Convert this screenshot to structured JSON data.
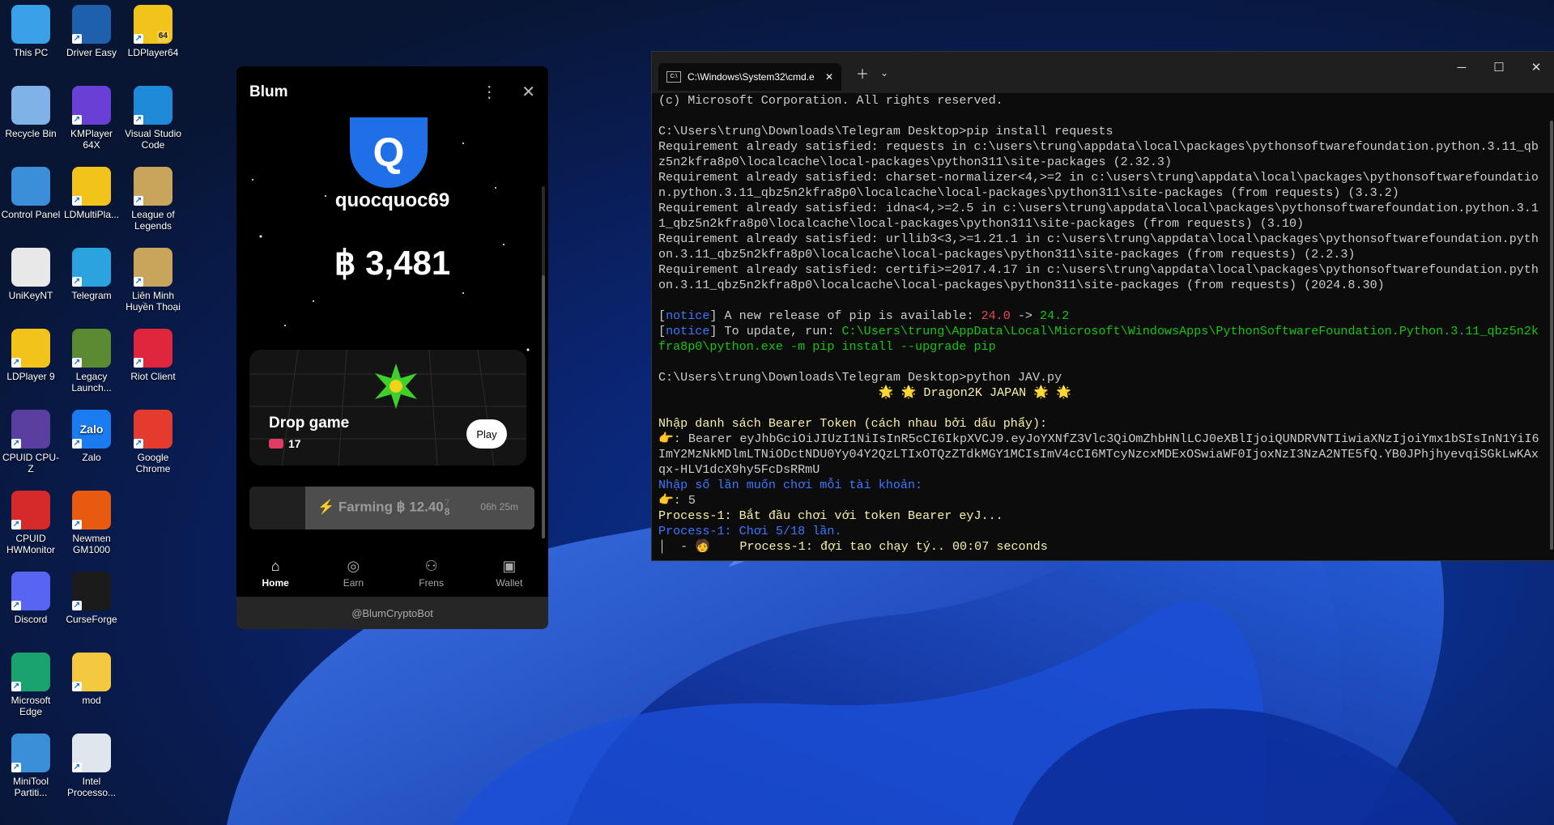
{
  "desktop": {
    "icons": [
      {
        "label": "This PC",
        "icon": "monitor-icon",
        "color": "#3aa0e8"
      },
      {
        "label": "Driver Easy",
        "icon": "driver-easy-icon",
        "color": "#1e5fae"
      },
      {
        "label": "LDPlayer64",
        "icon": "ldplayer-icon",
        "color": "#f2c31b",
        "badge": "64"
      },
      {
        "label": "Recycle Bin",
        "icon": "recycle-bin-icon",
        "color": "#7fb2e6"
      },
      {
        "label": "KMPlayer 64X",
        "icon": "kmplayer-icon",
        "color": "#6a3fd6"
      },
      {
        "label": "Visual Studio Code",
        "icon": "vscode-icon",
        "color": "#1f8ad8"
      },
      {
        "label": "Control Panel",
        "icon": "control-panel-icon",
        "color": "#3b8fd9"
      },
      {
        "label": "LDMultiPla...",
        "icon": "ldmultiplayer-icon",
        "color": "#f2c31b"
      },
      {
        "label": "League of Legends",
        "icon": "league-icon",
        "color": "#c8a55a"
      },
      {
        "label": "UniKeyNT",
        "icon": "unikey-icon",
        "color": "#e8e8e8"
      },
      {
        "label": "Telegram",
        "icon": "telegram-icon",
        "color": "#2aa3df"
      },
      {
        "label": "Liên Minh Huyền Thoại",
        "icon": "lmht-icon",
        "color": "#c8a55a"
      },
      {
        "label": "LDPlayer 9",
        "icon": "ldplayer9-icon",
        "color": "#f2c31b"
      },
      {
        "label": "Legacy Launch...",
        "icon": "minecraft-icon",
        "color": "#5c8a32"
      },
      {
        "label": "Riot Client",
        "icon": "riot-icon",
        "color": "#e0263c"
      },
      {
        "label": "CPUID CPU-Z",
        "icon": "cpuz-icon",
        "color": "#5a3fa0"
      },
      {
        "label": "Zalo",
        "icon": "zalo-icon",
        "color": "#1a7cf0",
        "glyph": "Zalo"
      },
      {
        "label": "Google Chrome",
        "icon": "chrome-icon",
        "color": "#e33b2e"
      },
      {
        "label": "CPUID HWMonitor",
        "icon": "hwmonitor-icon",
        "color": "#d42a2a"
      },
      {
        "label": "Newmen GM1000",
        "icon": "newmen-icon",
        "color": "#e85a10"
      },
      {
        "label": "",
        "icon": "empty",
        "color": ""
      },
      {
        "label": "Discord",
        "icon": "discord-icon",
        "color": "#5865f2"
      },
      {
        "label": "CurseForge",
        "icon": "curseforge-icon",
        "color": "#1b1b1b"
      },
      {
        "label": "",
        "icon": "empty",
        "color": ""
      },
      {
        "label": "Microsoft Edge",
        "icon": "edge-icon",
        "color": "#1aa36f"
      },
      {
        "label": "mod",
        "icon": "folder-icon",
        "color": "#f5c842"
      },
      {
        "label": "",
        "icon": "empty",
        "color": ""
      },
      {
        "label": "MiniTool Partiti...",
        "icon": "minitool-icon",
        "color": "#3b8fd9"
      },
      {
        "label": "Intel Processo...",
        "icon": "intel-doc-icon",
        "color": "#dfe6ee"
      }
    ]
  },
  "blum": {
    "title": "Blum",
    "avatar_letter": "Q",
    "username": "quocquoc69",
    "balance": "฿ 3,481",
    "drop_game": {
      "title": "Drop game",
      "tickets": "17",
      "play_label": "Play"
    },
    "farming": {
      "label": "⚡ Farming ฿ 12.40",
      "digit_top": "7",
      "digit_bottom": "8",
      "timer": "06h 25m",
      "progress": 0.8
    },
    "nav": [
      {
        "label": "Home",
        "icon": "home-icon"
      },
      {
        "label": "Earn",
        "icon": "earn-icon"
      },
      {
        "label": "Frens",
        "icon": "frens-icon"
      },
      {
        "label": "Wallet",
        "icon": "wallet-icon"
      }
    ],
    "footer": "@BlumCryptoBot"
  },
  "terminal": {
    "tab_title": "C:\\Windows\\System32\\cmd.e",
    "lines": [
      [
        {
          "t": "(c) Microsoft Corporation. All rights reserved.",
          "c": ""
        }
      ],
      [
        {
          "t": "",
          "c": ""
        }
      ],
      [
        {
          "t": "C:\\Users\\trung\\Downloads\\Telegram Desktop>pip install requests",
          "c": ""
        }
      ],
      [
        {
          "t": "Requirement already satisfied: requests in c:\\users\\trung\\appdata\\local\\packages\\pythonsoftwarefoundation.python.3.11_qb",
          "c": ""
        }
      ],
      [
        {
          "t": "z5n2kfra8p0\\localcache\\local-packages\\python311\\site-packages (2.32.3)",
          "c": ""
        }
      ],
      [
        {
          "t": "Requirement already satisfied: charset-normalizer<4,>=2 in c:\\users\\trung\\appdata\\local\\packages\\pythonsoftwarefoundatio",
          "c": ""
        }
      ],
      [
        {
          "t": "n.python.3.11_qbz5n2kfra8p0\\localcache\\local-packages\\python311\\site-packages (from requests) (3.3.2)",
          "c": ""
        }
      ],
      [
        {
          "t": "Requirement already satisfied: idna<4,>=2.5 in c:\\users\\trung\\appdata\\local\\packages\\pythonsoftwarefoundation.python.3.1",
          "c": ""
        }
      ],
      [
        {
          "t": "1_qbz5n2kfra8p0\\localcache\\local-packages\\python311\\site-packages (from requests) (3.10)",
          "c": ""
        }
      ],
      [
        {
          "t": "Requirement already satisfied: urllib3<3,>=1.21.1 in c:\\users\\trung\\appdata\\local\\packages\\pythonsoftwarefoundation.pyth",
          "c": ""
        }
      ],
      [
        {
          "t": "on.3.11_qbz5n2kfra8p0\\localcache\\local-packages\\python311\\site-packages (from requests) (2.2.3)",
          "c": ""
        }
      ],
      [
        {
          "t": "Requirement already satisfied: certifi>=2017.4.17 in c:\\users\\trung\\appdata\\local\\packages\\pythonsoftwarefoundation.pyth",
          "c": ""
        }
      ],
      [
        {
          "t": "on.3.11_qbz5n2kfra8p0\\localcache\\local-packages\\python311\\site-packages (from requests) (2024.8.30)",
          "c": ""
        }
      ],
      [
        {
          "t": "",
          "c": ""
        }
      ],
      [
        {
          "t": "[",
          "c": ""
        },
        {
          "t": "notice",
          "c": "c-blue"
        },
        {
          "t": "] A new release of pip is available: ",
          "c": ""
        },
        {
          "t": "24.0",
          "c": "c-red"
        },
        {
          "t": " -> ",
          "c": ""
        },
        {
          "t": "24.2",
          "c": "c-green"
        }
      ],
      [
        {
          "t": "[",
          "c": ""
        },
        {
          "t": "notice",
          "c": "c-blue"
        },
        {
          "t": "] To update, run: ",
          "c": ""
        },
        {
          "t": "C:\\Users\\trung\\AppData\\Local\\Microsoft\\WindowsApps\\PythonSoftwareFoundation.Python.3.11_qbz5n2k",
          "c": "c-green"
        }
      ],
      [
        {
          "t": "fra8p0\\python.exe -m pip install --upgrade pip",
          "c": "c-green"
        }
      ],
      [
        {
          "t": "",
          "c": ""
        }
      ],
      [
        {
          "t": "C:\\Users\\trung\\Downloads\\Telegram Desktop>python JAV.py",
          "c": ""
        }
      ],
      [
        {
          "t": "                              🌟 🌟 Dragon2K JAPAN 🌟 🌟",
          "c": "c-yel"
        }
      ],
      [
        {
          "t": "",
          "c": ""
        }
      ],
      [
        {
          "t": "Nhập danh sách Bearer Token (cách nhau bởi dấu phẩy):",
          "c": "c-yel"
        }
      ],
      [
        {
          "t": "👉: Bearer eyJhbGciOiJIUzI1NiIsInR5cCI6IkpXVCJ9.eyJoYXNfZ3Vlc3QiOmZhbHNlLCJ0eXBlIjoiQUNDRVNTIiwiaXNzIjoiYmx1bSIsInN1YiI6",
          "c": ""
        }
      ],
      [
        {
          "t": "ImY2MzNkMDlmLTNiODctNDU0Yy04Y2QzLTIxOTQzZTdkMGY1MCIsImV4cCI6MTcyNzcxMDExOSwiaWF0IjoxNzI3NzA2NTE5fQ.YB0JPhjhyevqiSGkLwKAx",
          "c": ""
        }
      ],
      [
        {
          "t": "qx-HLV1dcX9hy5FcDsRRmU",
          "c": ""
        }
      ],
      [
        {
          "t": "Nhập số lần muốn chơi mỗi tài khoản:",
          "c": "c-cyan"
        }
      ],
      [
        {
          "t": "👉: 5",
          "c": ""
        }
      ],
      [
        {
          "t": "Process-1: Bắt đầu chơi với token Bearer eyJ...",
          "c": "c-yel"
        }
      ],
      [
        {
          "t": "Process-1: Chơi 5/18 lần.",
          "c": "c-cyan"
        }
      ],
      [
        {
          "t": "│  - 🧑    ",
          "c": ""
        },
        {
          "t": "Process-1: đợi tao chạy tý.. 00:07 seconds",
          "c": "c-yel"
        }
      ]
    ]
  }
}
